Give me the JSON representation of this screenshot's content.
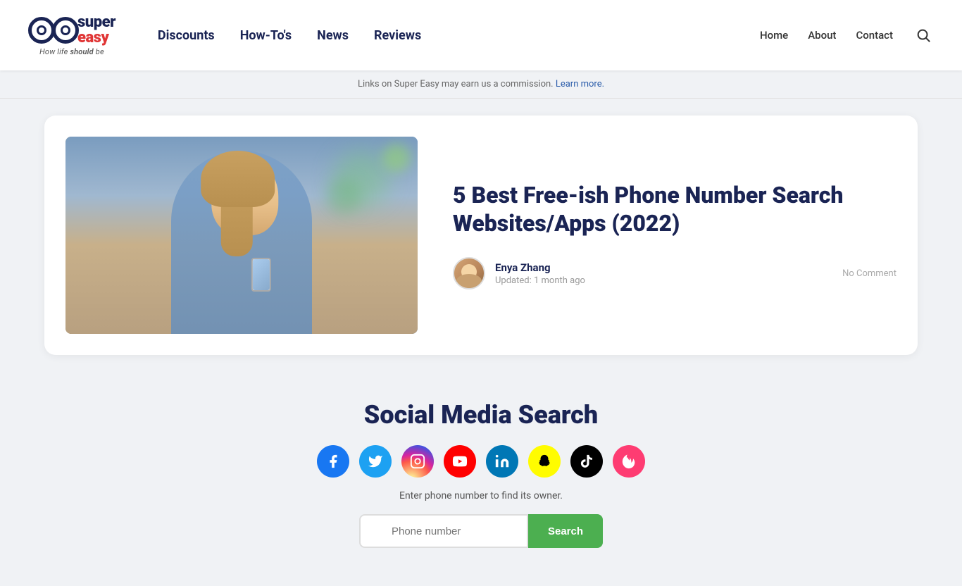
{
  "header": {
    "logo": {
      "brand_super": "super",
      "brand_easy": "easy",
      "tagline_normal": "How life ",
      "tagline_italic": "should",
      "tagline_end": " be"
    },
    "nav": {
      "items": [
        {
          "label": "Discounts",
          "href": "#"
        },
        {
          "label": "How-To's",
          "href": "#"
        },
        {
          "label": "News",
          "href": "#"
        },
        {
          "label": "Reviews",
          "href": "#"
        }
      ]
    },
    "right_nav": {
      "items": [
        {
          "label": "Home",
          "href": "#"
        },
        {
          "label": "About",
          "href": "#"
        },
        {
          "label": "Contact",
          "href": "#"
        }
      ]
    }
  },
  "commission_bar": {
    "text": "Links on Super Easy may earn us a commission.",
    "link_text": "Learn more."
  },
  "article": {
    "title": "5 Best Free-ish Phone Number Search Websites/Apps (2022)",
    "author_name": "Enya Zhang",
    "updated": "Updated: 1 month ago",
    "no_comment": "No Comment"
  },
  "social_section": {
    "title": "Social Media Search",
    "helper_text": "Enter phone number to find its owner.",
    "icons": [
      {
        "name": "facebook",
        "class": "si-facebook",
        "symbol": "f"
      },
      {
        "name": "twitter",
        "class": "si-twitter",
        "symbol": "t"
      },
      {
        "name": "instagram",
        "class": "si-instagram",
        "symbol": "📷"
      },
      {
        "name": "youtube",
        "class": "si-youtube",
        "symbol": "▶"
      },
      {
        "name": "linkedin",
        "class": "si-linkedin",
        "symbol": "in"
      },
      {
        "name": "snapchat",
        "class": "si-snapchat",
        "symbol": "👻"
      },
      {
        "name": "tiktok",
        "class": "si-tiktok",
        "symbol": "♪"
      },
      {
        "name": "tinder",
        "class": "si-tinder",
        "symbol": "🔥"
      }
    ],
    "input_placeholder": "Phone number",
    "search_btn_label": "Search"
  }
}
